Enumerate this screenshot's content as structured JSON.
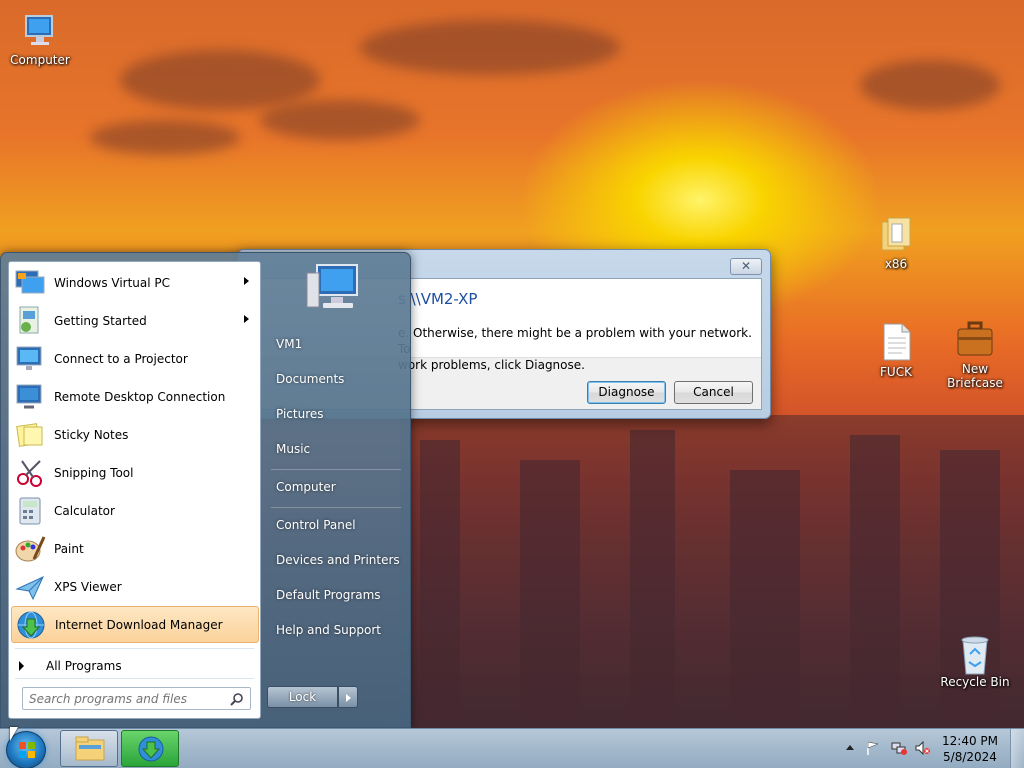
{
  "desktop": {
    "icons": {
      "computer": "Computer",
      "x86": "x86",
      "fuck": "FUCK",
      "briefcase": "New Briefcase",
      "recycle": "Recycle Bin"
    }
  },
  "dialog": {
    "close_glyph": "✕",
    "heading": "s \\\\VM2-XP",
    "message_line1": "e. Otherwise, there might be a problem with your network. To",
    "message_line2": "work problems, click Diagnose.",
    "diagnose_label": "Diagnose",
    "cancel_label": "Cancel"
  },
  "start_menu": {
    "programs": [
      {
        "label": "Windows Virtual PC",
        "icon": "virtual-pc-icon",
        "has_submenu": true
      },
      {
        "label": "Getting Started",
        "icon": "getting-started-icon",
        "has_submenu": true
      },
      {
        "label": "Connect to a Projector",
        "icon": "projector-icon",
        "has_submenu": false
      },
      {
        "label": "Remote Desktop Connection",
        "icon": "remote-desktop-icon",
        "has_submenu": false
      },
      {
        "label": "Sticky Notes",
        "icon": "sticky-notes-icon",
        "has_submenu": false
      },
      {
        "label": "Snipping Tool",
        "icon": "scissors-icon",
        "has_submenu": false
      },
      {
        "label": "Calculator",
        "icon": "calculator-icon",
        "has_submenu": false
      },
      {
        "label": "Paint",
        "icon": "paint-palette-icon",
        "has_submenu": false
      },
      {
        "label": "XPS Viewer",
        "icon": "xps-viewer-icon",
        "has_submenu": false
      },
      {
        "label": "Internet Download Manager",
        "icon": "idm-globe-icon",
        "has_submenu": false
      }
    ],
    "all_programs": "All Programs",
    "search_placeholder": "Search programs and files",
    "right_items": [
      "VM1",
      "Documents",
      "Pictures",
      "Music",
      "Computer",
      "Control Panel",
      "Devices and Printers",
      "Default Programs",
      "Help and Support"
    ],
    "lock_label": "Lock"
  },
  "taskbar": {
    "time": "12:40 PM",
    "date": "5/8/2024"
  },
  "colors": {
    "accent": "#1e4fa0",
    "highlight": "#fbd29a"
  }
}
